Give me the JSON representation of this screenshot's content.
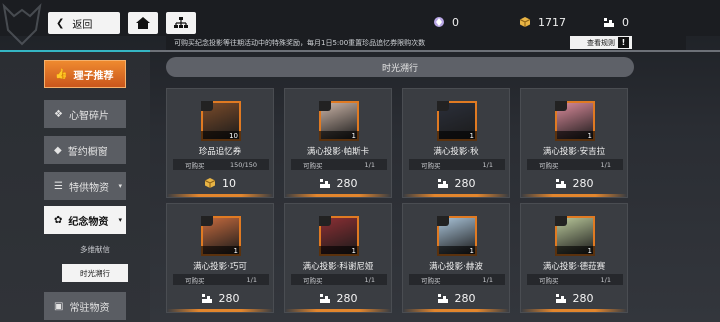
{
  "header": {
    "back_label": "返回",
    "currencies": [
      {
        "icon": "diamond-icon",
        "value": "0"
      },
      {
        "icon": "gold-cube-icon",
        "value": "1717"
      },
      {
        "icon": "token-icon",
        "value": "0"
      }
    ],
    "notice": "可购买纪念投影等往期活动中的特殊奖励，每月1日5:00重置珍品追忆券限购次数",
    "rules_label": "查看规则",
    "warn_label": "!"
  },
  "sidebar": {
    "items": [
      {
        "label": "理子推荐",
        "icon": "thumb-up-icon",
        "state": "active-top"
      },
      {
        "label": "心智碎片",
        "icon": "puzzle-icon",
        "state": "normal"
      },
      {
        "label": "誓约橱窗",
        "icon": "gem-icon",
        "state": "normal"
      },
      {
        "label": "特供物资",
        "icon": "layers-icon",
        "state": "normal",
        "caret": "▾"
      },
      {
        "label": "纪念物资",
        "icon": "ribbon-icon",
        "state": "active",
        "caret": "▾"
      },
      {
        "label": "常驻物资",
        "icon": "box-icon",
        "state": "normal"
      }
    ],
    "subitems": [
      {
        "label": "多维献信",
        "selected": false
      },
      {
        "label": "时光溯行",
        "selected": true
      }
    ]
  },
  "main": {
    "section_title": "时光溯行",
    "cards": [
      {
        "name": "珍品追忆券",
        "limit_label": "可购买",
        "limit": "150/150",
        "price": "10",
        "price_icon": "gold-cube-icon",
        "count": "10",
        "portrait_color": "#7a4b2a"
      },
      {
        "name": "满心投影·帕斯卡",
        "limit_label": "可购买",
        "limit": "1/1",
        "price": "280",
        "price_icon": "token-icon",
        "count": "1",
        "portrait_color": "#c9b3a6"
      },
      {
        "name": "满心投影·秋",
        "limit_label": "可购买",
        "limit": "1/1",
        "price": "280",
        "price_icon": "token-icon",
        "count": "1",
        "portrait_color": "#2b2f3a"
      },
      {
        "name": "满心投影·安吉拉",
        "limit_label": "可购买",
        "limit": "1/1",
        "price": "280",
        "price_icon": "token-icon",
        "count": "1",
        "portrait_color": "#d98a9a"
      },
      {
        "name": "满心投影·巧可",
        "limit_label": "可购买",
        "limit": "1/1",
        "price": "280",
        "price_icon": "token-icon",
        "count": "1",
        "portrait_color": "#c46a3e"
      },
      {
        "name": "满心投影·科谢尼娅",
        "limit_label": "可购买",
        "limit": "1/1",
        "price": "280",
        "price_icon": "token-icon",
        "count": "1",
        "portrait_color": "#8c2f34"
      },
      {
        "name": "满心投影·赫波",
        "limit_label": "可购买",
        "limit": "1/1",
        "price": "280",
        "price_icon": "token-icon",
        "count": "1",
        "portrait_color": "#a9c3d8"
      },
      {
        "name": "满心投影·德菈赛",
        "limit_label": "可购买",
        "limit": "1/1",
        "price": "280",
        "price_icon": "token-icon",
        "count": "1",
        "portrait_color": "#b9c79a"
      }
    ]
  },
  "colors": {
    "accent": "#e3862d",
    "teal": "#35b6c4"
  }
}
